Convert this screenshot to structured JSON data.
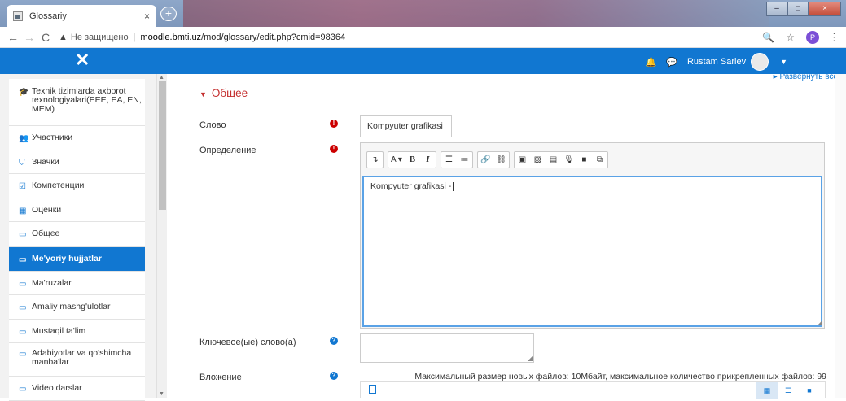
{
  "browser": {
    "tab_title": "Glossariy",
    "tab_close": "×",
    "new_tab": "+",
    "back": "←",
    "forward": "→",
    "reload": "C",
    "warning": "▲",
    "not_secure": "Не защищено",
    "url_host": "moodle.bmti.uz",
    "url_path": "/mod/glossary/edit.php?cmid=98364",
    "zoom_icon": "🔍",
    "star_icon": "☆",
    "profile_initial": "P",
    "menu_icon": "⋮",
    "window_controls": [
      "–",
      "□",
      "×"
    ]
  },
  "navbar": {
    "close_icon": "✕",
    "bell_icon": "🔔",
    "chat_icon": "💬",
    "username": "Rustam Sariev",
    "caret": "▼",
    "bg": "#1177d1"
  },
  "sidebar": {
    "items": [
      {
        "label": "Texnik tizimlarda axborot texnologiyalari(EEE, EA, EN, MEM)",
        "icon": "graduation-cap-icon",
        "glyph": "🎓",
        "active": false
      },
      {
        "label": "Участники",
        "icon": "users-icon",
        "glyph": "👥",
        "active": false
      },
      {
        "label": "Значки",
        "icon": "shield-icon",
        "glyph": "⛉",
        "active": false
      },
      {
        "label": "Компетенции",
        "icon": "check-square-icon",
        "glyph": "☑",
        "active": false
      },
      {
        "label": "Оценки",
        "icon": "table-icon",
        "glyph": "▦",
        "active": false
      },
      {
        "label": "Общее",
        "icon": "folder-icon",
        "glyph": "▭",
        "active": false
      },
      {
        "label": "Me'yoriy hujjatlar",
        "icon": "folder-icon",
        "glyph": "▭",
        "active": true
      },
      {
        "label": "Ma'ruzalar",
        "icon": "folder-icon",
        "glyph": "▭",
        "active": false
      },
      {
        "label": "Amaliy mashg'ulotlar",
        "icon": "folder-icon",
        "glyph": "▭",
        "active": false
      },
      {
        "label": "Mustaqil ta'lim",
        "icon": "folder-icon",
        "glyph": "▭",
        "active": false
      },
      {
        "label": "Adabiyotlar va qo'shimcha manba'lar",
        "icon": "folder-icon",
        "glyph": "▭",
        "active": false
      },
      {
        "label": "Video darslar",
        "icon": "folder-icon",
        "glyph": "▭",
        "active": false
      }
    ]
  },
  "main": {
    "expand_all": "Развернуть всё",
    "section_title": "Общее",
    "word": {
      "label": "Слово",
      "value": "Kompyuter grafikasi"
    },
    "definition": {
      "label": "Определение",
      "content": "Kompyuter grafikasi -"
    },
    "keywords": {
      "label": "Ключевое(ые) слово(а)"
    },
    "attachment": {
      "label": "Вложение",
      "info": "Максимальный размер новых файлов: 10Мбайт, максимальное количество прикрепленных файлов: 99"
    },
    "toolbar_groups": [
      [
        "↴"
      ],
      [
        "A ▾",
        "B",
        "I"
      ],
      [
        "☰",
        "≔"
      ],
      [
        "🔗",
        "⛓"
      ],
      [
        "▣",
        "▨",
        "▤",
        "🎙",
        "■",
        "⧉"
      ]
    ],
    "required_glyph": "!",
    "help_glyph": "?"
  }
}
